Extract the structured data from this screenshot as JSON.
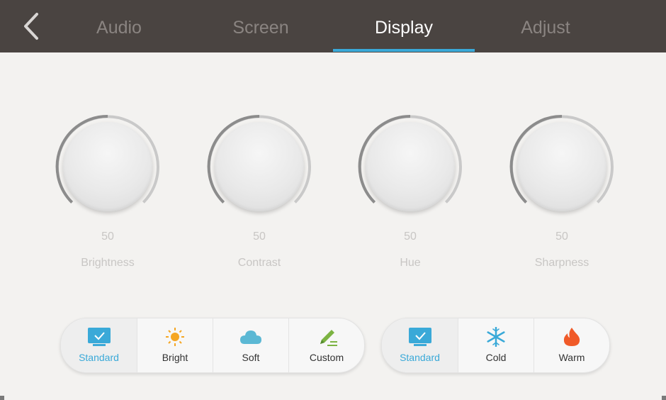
{
  "header": {
    "tabs": [
      {
        "label": "Audio",
        "active": false
      },
      {
        "label": "Screen",
        "active": false
      },
      {
        "label": "Display",
        "active": true
      },
      {
        "label": "Adjust",
        "active": false
      }
    ],
    "accent_color": "#3aa9d8",
    "background_color": "#4a4441"
  },
  "knobs": [
    {
      "value": "50",
      "label": "Brightness"
    },
    {
      "value": "50",
      "label": "Contrast"
    },
    {
      "value": "50",
      "label": "Hue"
    },
    {
      "value": "50",
      "label": "Sharpness"
    }
  ],
  "picture_modes": [
    {
      "label": "Standard",
      "icon": "check-screen-icon",
      "selected": true
    },
    {
      "label": "Bright",
      "icon": "sun-icon",
      "selected": false
    },
    {
      "label": "Soft",
      "icon": "cloud-icon",
      "selected": false
    },
    {
      "label": "Custom",
      "icon": "pencil-icon",
      "selected": false
    }
  ],
  "color_temperatures": [
    {
      "label": "Standard",
      "icon": "check-screen-icon",
      "selected": true
    },
    {
      "label": "Cold",
      "icon": "snowflake-icon",
      "selected": false
    },
    {
      "label": "Warm",
      "icon": "flame-icon",
      "selected": false
    }
  ]
}
